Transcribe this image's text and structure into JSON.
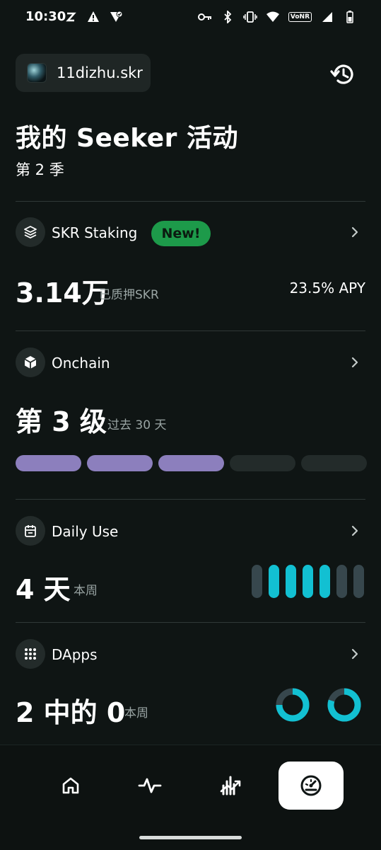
{
  "status_bar": {
    "time": "10:30",
    "network_badge": "VoNR"
  },
  "header": {
    "account_name": "11dizhu.skr"
  },
  "page": {
    "title": "我的 Seeker 活动",
    "season": "第 2 季"
  },
  "staking": {
    "title": "SKR Staking",
    "badge": "New!",
    "value": "3.14万",
    "value_label": "已质押SKR",
    "apy": "23.5% APY"
  },
  "onchain": {
    "title": "Onchain",
    "level": "第 3 级",
    "period": "过去 30 天",
    "progress_filled": 3,
    "progress_total": 5
  },
  "daily_use": {
    "title": "Daily Use",
    "value": "4 天",
    "period": "本周",
    "days_active": [
      false,
      true,
      true,
      true,
      true,
      false,
      false
    ]
  },
  "dapps": {
    "title": "DApps",
    "value": "2 中的 0",
    "period": "本周"
  },
  "nav": {
    "items": [
      "home-icon",
      "activity-icon",
      "trending-icon",
      "speedometer-icon"
    ],
    "active_index": 3
  },
  "colors": {
    "background": "#0f1514",
    "accent_purple": "#8c7fbd",
    "accent_cyan": "#12c0d2",
    "badge_green": "#1d9a4a"
  }
}
